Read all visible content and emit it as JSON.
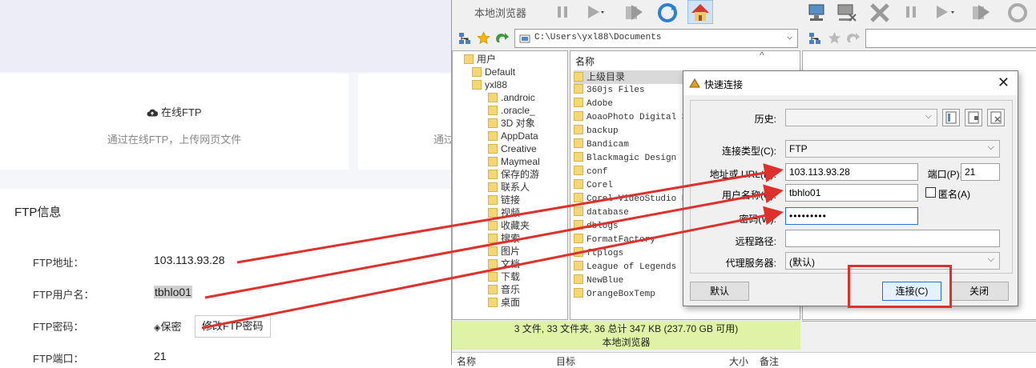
{
  "web": {
    "card1": {
      "title": "在线FTP",
      "desc": "通过在线FTP，上传网页文件"
    },
    "card2": {
      "desc": "通过"
    },
    "ftp_info": {
      "heading": "FTP信息",
      "rows": [
        {
          "label": "FTP地址：",
          "value": "103.113.93.28"
        },
        {
          "label": "FTP用户名：",
          "value": "tbhlo01"
        },
        {
          "label": "FTP密码：",
          "value": "保密"
        },
        {
          "label": "FTP端口：",
          "value": "21"
        }
      ],
      "change_password_button": "修改FTP密码"
    }
  },
  "client": {
    "local_label": "本地浏览器",
    "local_path": "C:\\Users\\yxl88\\Documents",
    "tree": [
      {
        "label": "用户",
        "level": 1
      },
      {
        "label": "Default",
        "level": 2
      },
      {
        "label": "yxl88",
        "level": 2
      },
      {
        "label": ".androic",
        "level": 3
      },
      {
        "label": ".oracle_",
        "level": 3
      },
      {
        "label": "3D 对象",
        "level": 3
      },
      {
        "label": "AppData",
        "level": 3
      },
      {
        "label": "Creative",
        "level": 3
      },
      {
        "label": "Maymeal",
        "level": 3
      },
      {
        "label": "保存的游",
        "level": 3
      },
      {
        "label": "联系人",
        "level": 3
      },
      {
        "label": "链接",
        "level": 3
      },
      {
        "label": "视频",
        "level": 3
      },
      {
        "label": "收藏夹",
        "level": 3
      },
      {
        "label": "搜索",
        "level": 3
      },
      {
        "label": "图片",
        "level": 3
      },
      {
        "label": "文档",
        "level": 3
      },
      {
        "label": "下载",
        "level": 3
      },
      {
        "label": "音乐",
        "level": 3
      },
      {
        "label": "桌面",
        "level": 3
      }
    ],
    "files_header": "名称",
    "files": [
      "上级目录",
      "360js Files",
      "Adobe",
      "AoaoPhoto Digital St",
      "backup",
      "Bandicam",
      "Blackmagic Design",
      "conf",
      "Corel",
      "Corel VideoStudio Pr",
      "database",
      "dblogs",
      "FormatFactory",
      "ftplogs",
      "League of Legends",
      "NewBlue",
      "OrangeBoxTemp"
    ],
    "status_line1": "3 文件, 33 文件夹, 36 总计 347 KB (237.70 GB 可用)",
    "status_line2": "本地浏览器",
    "bottom_cols": [
      "名称",
      "目标",
      "大小",
      "备注"
    ]
  },
  "dialog": {
    "title": "快速连接",
    "history_label": "历史:",
    "conn_type_label": "连接类型(C):",
    "conn_type_value": "FTP",
    "address_label": "地址或 URL(D):",
    "address_value": "103.113.93.28",
    "port_label": "端口(P):",
    "port_value": "21",
    "username_label": "用户名称(U):",
    "username_value": "tbhlo01",
    "anon_label": "匿名(A)",
    "password_label": "密码(W):",
    "password_value": "•••••••••",
    "remote_path_label": "远程路径:",
    "proxy_label": "代理服务器:",
    "proxy_value": "(默认)",
    "default_button": "默认",
    "connect_button": "连接(C)",
    "close_button": "关闭"
  },
  "colors": {
    "arrow": "#e0302c",
    "status_bg": "#dff2a6",
    "accent": "#2a6fd6"
  }
}
